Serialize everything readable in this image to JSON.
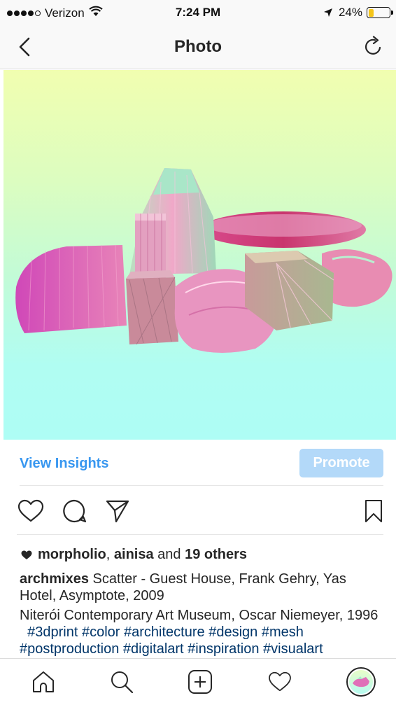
{
  "status_bar": {
    "carrier": "Verizon",
    "time": "7:24 PM",
    "battery": "24%",
    "battery_level": 0.24,
    "battery_color": "#f5c518"
  },
  "nav": {
    "title": "Photo",
    "back_icon": "chevron-left-icon",
    "refresh_icon": "refresh-icon"
  },
  "photo": {
    "gradient_top": "#f1feb0",
    "gradient_bottom": "#aefdf5"
  },
  "insights": {
    "view_insights_label": "View Insights",
    "promote_label": "Promote",
    "accent": "#3897f0"
  },
  "actions": {
    "like_icon": "heart-icon",
    "comment_icon": "comment-icon",
    "share_icon": "paper-plane-icon",
    "save_icon": "bookmark-icon"
  },
  "likes": {
    "user1": "morpholio",
    "sep1": ", ",
    "user2": "ainisa",
    "sep2": " and ",
    "others": "19 others"
  },
  "caption": {
    "username": "archmixes",
    "text": "Scatter - Guest House, Frank Gehry, Yas Hotel, Asymptote, 2009",
    "line2": "Niterói Contemporary Art Museum, Oscar Niemeyer, 1996",
    "hashtags": [
      "#3dprint",
      "#color",
      "#architecture",
      "#design",
      "#mesh",
      "#postproduction",
      "#digitalart",
      "#inspiration",
      "#visualart"
    ]
  },
  "tab_bar": {
    "items": [
      "home-icon",
      "search-icon",
      "add-icon",
      "activity-icon",
      "profile-avatar"
    ]
  }
}
